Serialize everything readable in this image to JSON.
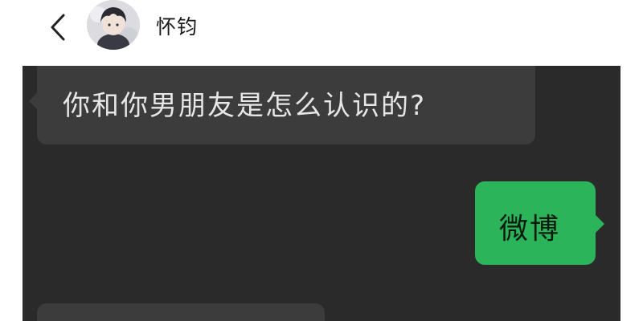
{
  "header": {
    "contact_name": "怀钧",
    "back_icon": "chevron-left-icon",
    "avatar_icon": "avatar"
  },
  "messages": [
    {
      "side": "incoming",
      "text": "你和你男朋友是怎么认识的?"
    },
    {
      "side": "outgoing",
      "text": "微博"
    },
    {
      "side": "incoming",
      "text": ""
    }
  ],
  "colors": {
    "chat_background": "#2a2a2a",
    "incoming_bubble": "#3c3c3c",
    "outgoing_bubble": "#2bb45a",
    "header_background": "#ffffff"
  }
}
